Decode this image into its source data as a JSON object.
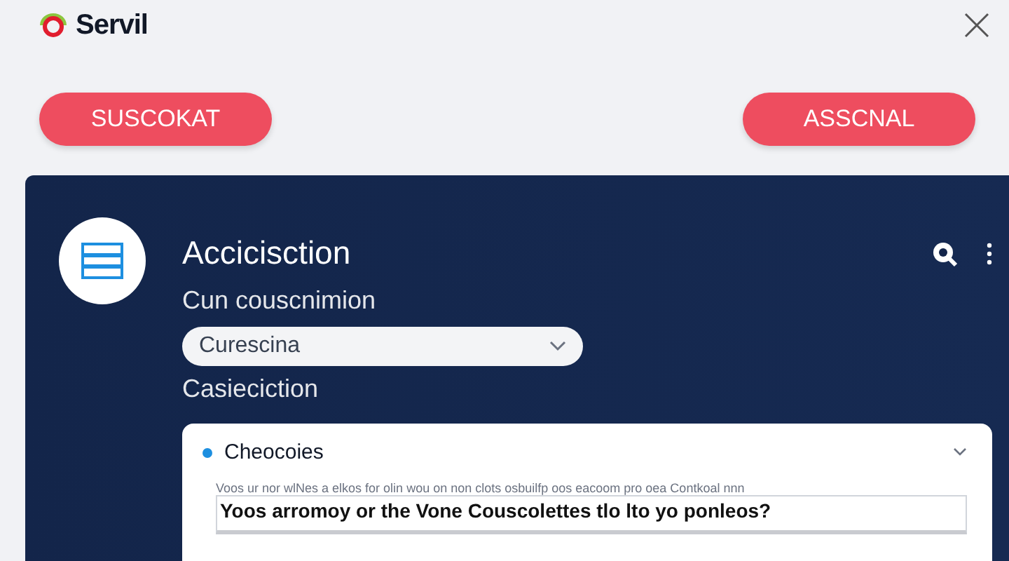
{
  "app": {
    "title": "Servil"
  },
  "actions": [
    {
      "label": "SUSCOKAT"
    },
    {
      "label": "ASSCNAL"
    }
  ],
  "panel": {
    "title": "Accicisction",
    "subtitle": "Cun couscnimion",
    "select": {
      "value": "Curescina"
    },
    "section_label": "Casieciction",
    "card": {
      "title": "Cheocoies",
      "expanded": true,
      "hint": "Voos ur nor wlNes a elkos for olin wou on non clots osbuilfp oos eacoom pro oea Contkoal nnn",
      "question": "Yoos arromoy or the Vone Couscolettes tlo lto yo ponleos?"
    }
  }
}
